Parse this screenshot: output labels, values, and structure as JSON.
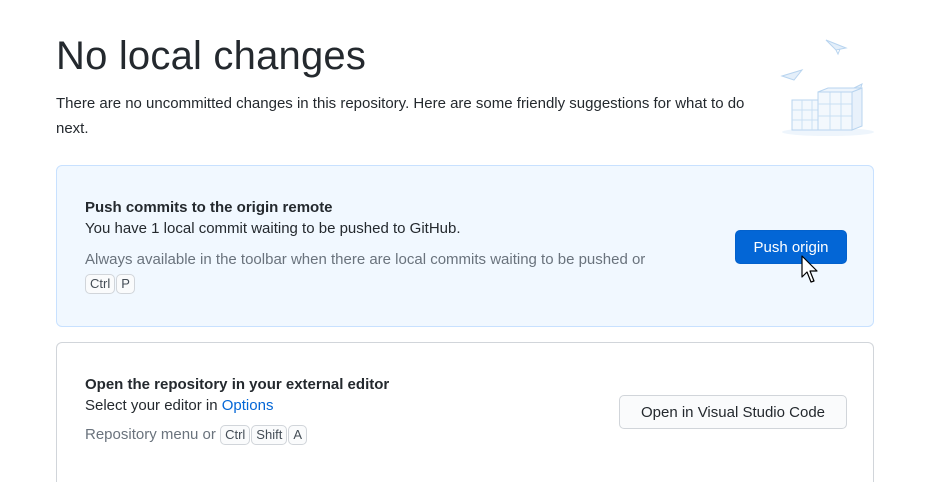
{
  "header": {
    "title": "No local changes",
    "description": "There are no uncommitted changes in this repository. Here are some friendly suggestions for what to do next."
  },
  "illustration": {
    "icon": "empty-changes-illustration-icon"
  },
  "push_card": {
    "title": "Push commits to the origin remote",
    "description": "You have 1 local commit waiting to be pushed to GitHub.",
    "hint": "Always available in the toolbar when there are local commits waiting to be pushed or",
    "shortcut_keys": [
      "Ctrl",
      "P"
    ],
    "button_label": "Push origin"
  },
  "editor_card": {
    "title": "Open the repository in your external editor",
    "description_prefix": "Select your editor in",
    "description_link": "Options",
    "hint": "Repository menu or",
    "shortcut_keys": [
      "Ctrl",
      "Shift",
      "A"
    ],
    "button_label": "Open in Visual Studio Code"
  },
  "colors": {
    "accent": "#0366d6",
    "highlight_bg": "#f1f8ff",
    "highlight_border": "#c8e1ff"
  }
}
